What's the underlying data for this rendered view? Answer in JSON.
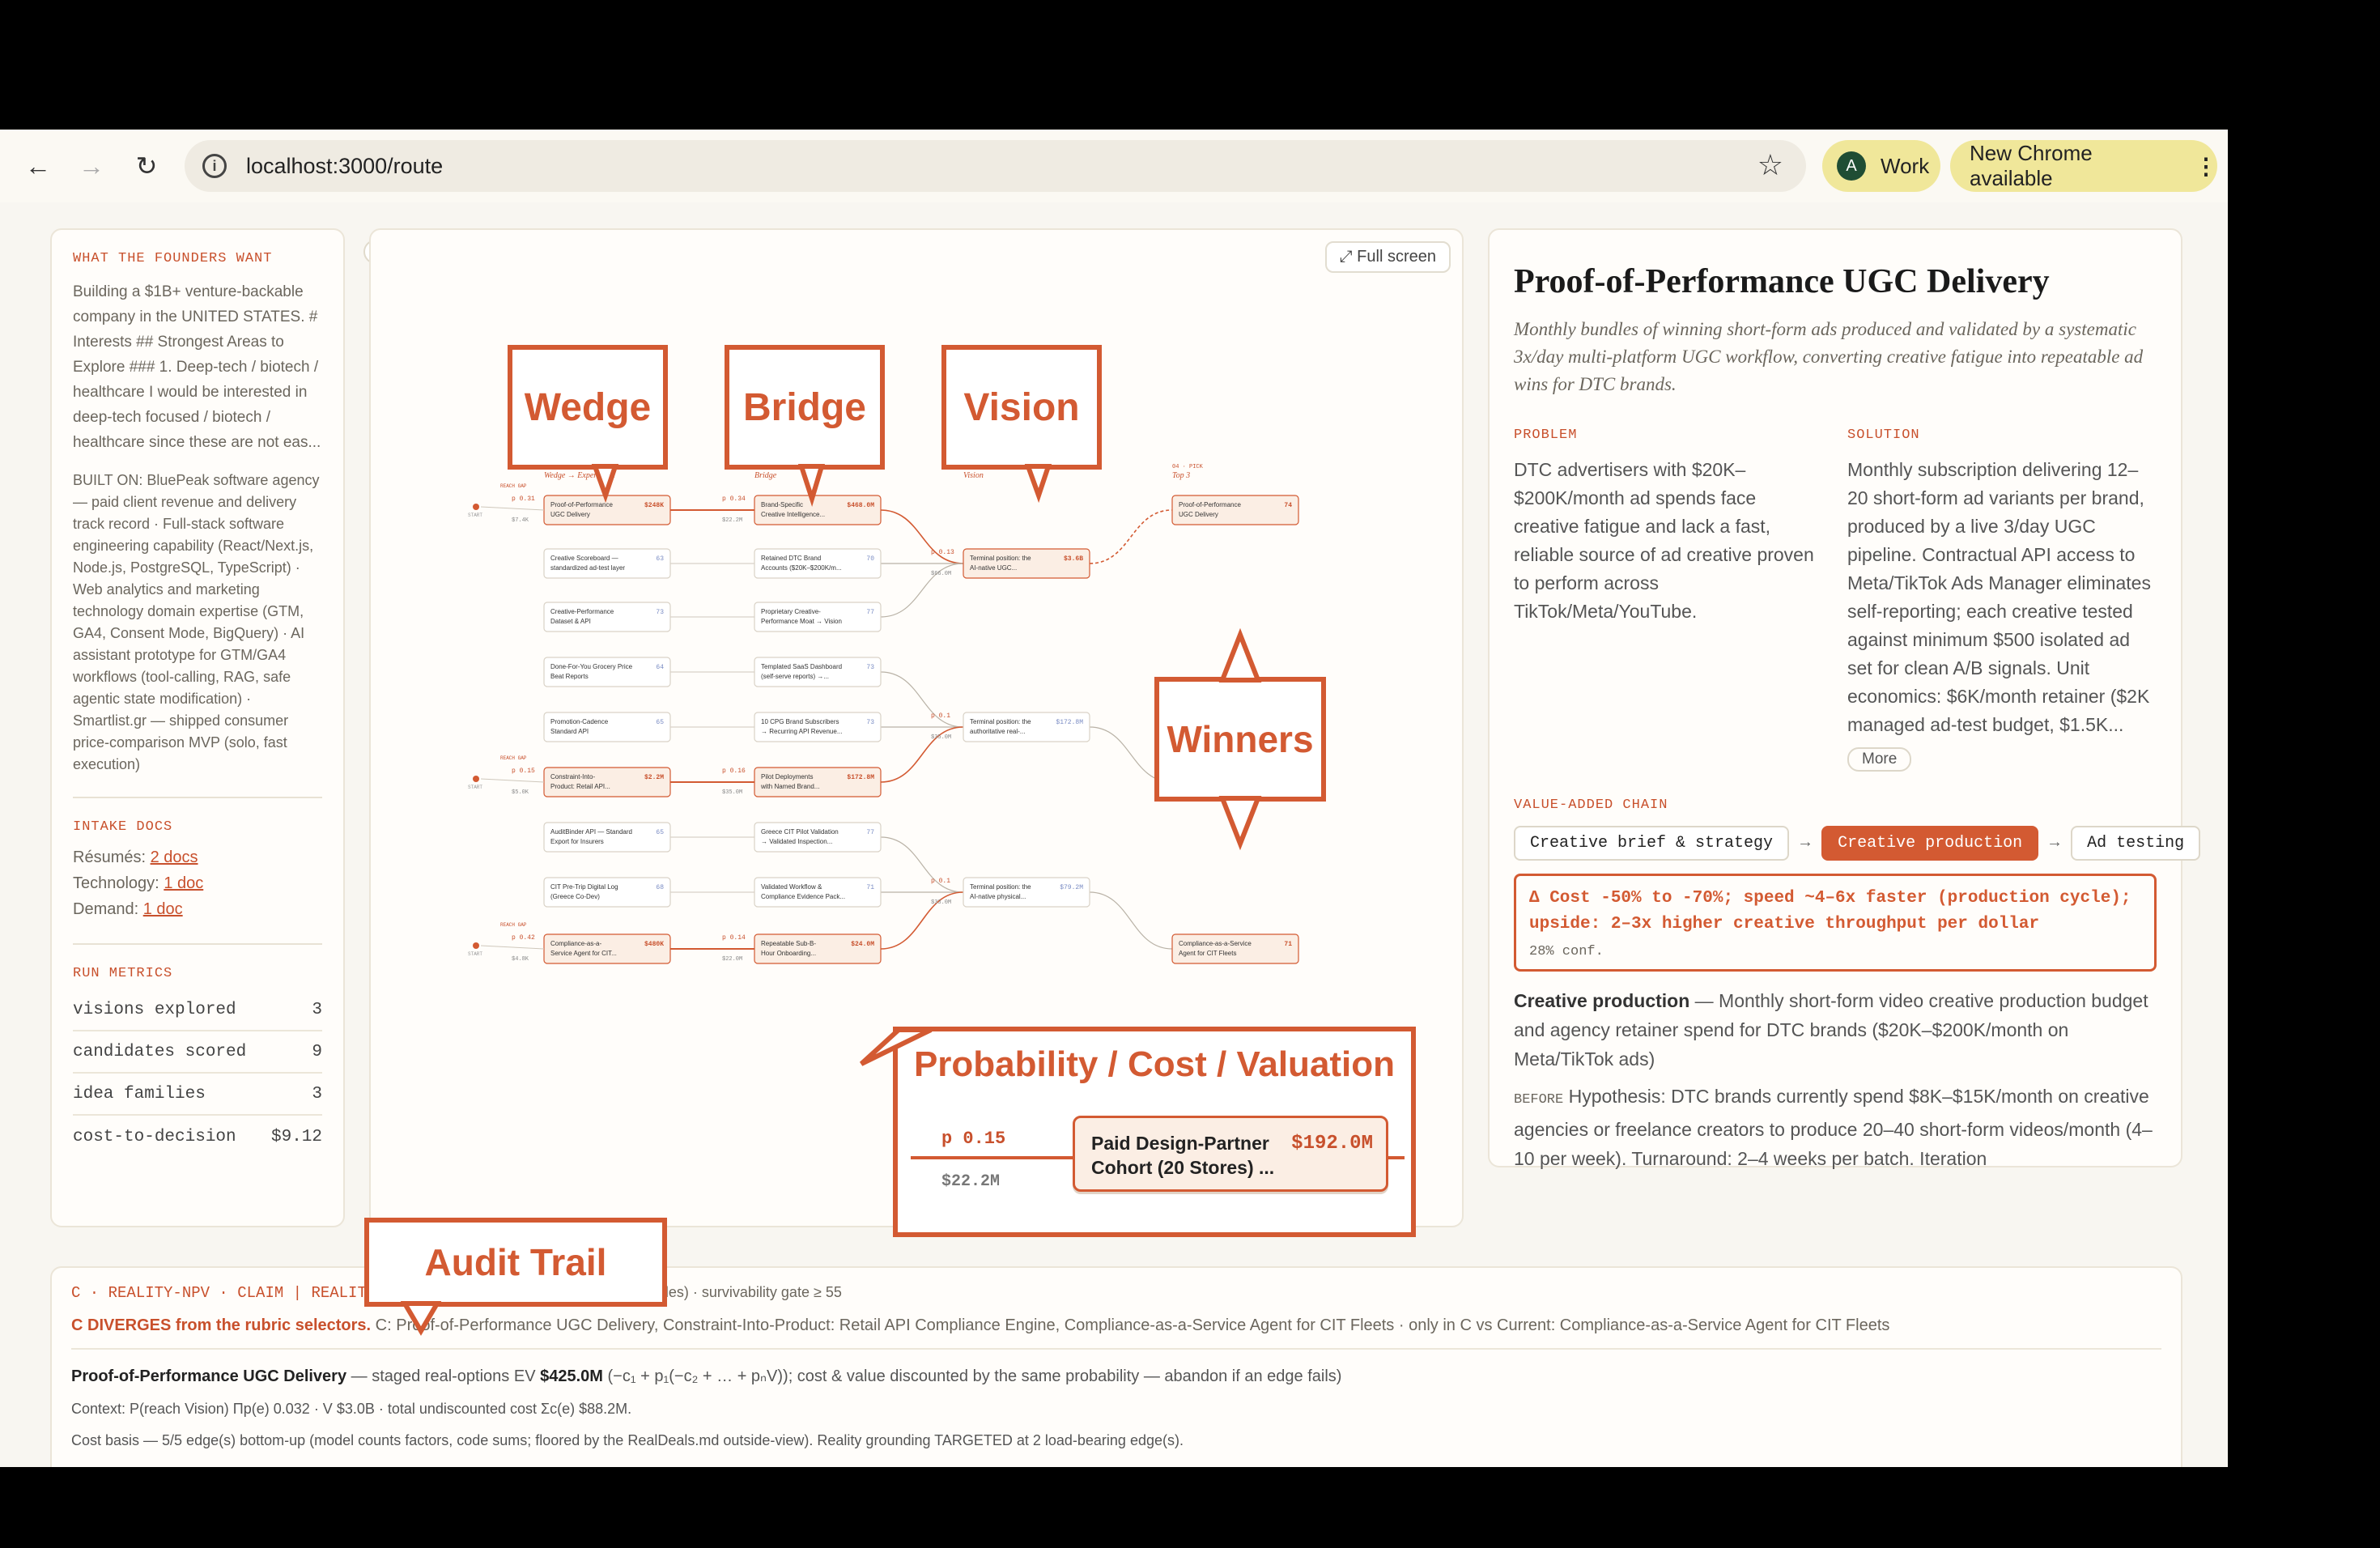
{
  "browser": {
    "url": "localhost:3000/route",
    "profile_initial": "A",
    "profile_label": "Work",
    "update_label": "New Chrome available"
  },
  "left": {
    "founders_title": "WHAT THE FOUNDERS WANT",
    "founders_text": "Building a $1B+ venture-backable company in the UNITED STATES. # Interests ## Strongest Areas to Explore ### 1. Deep-tech / biotech / healthcare I would be interested in deep-tech focused / biotech / healthcare since these are not eas...",
    "built_on": "BUILT ON: BluePeak software agency — paid client revenue and delivery track record · Full-stack software engineering capability (React/Next.js, Node.js, PostgreSQL, TypeScript) · Web analytics and marketing technology domain expertise (GTM, GA4, Consent Mode, BigQuery) · AI assistant prototype for GTM/GA4 workflows (tool-calling, RAG, safe agentic state modification) · Smartlist.gr — shipped consumer price-comparison MVP (solo, fast execution)",
    "intake_title": "INTAKE DOCS",
    "intake": [
      {
        "label": "Résumés:",
        "link": "2 docs"
      },
      {
        "label": "Technology:",
        "link": "1 doc"
      },
      {
        "label": "Demand:",
        "link": "1 doc"
      }
    ],
    "metrics_title": "RUN METRICS",
    "metrics": [
      {
        "label": "visions explored",
        "value": "3"
      },
      {
        "label": "candidates scored",
        "value": "9"
      },
      {
        "label": "idea families",
        "value": "3"
      },
      {
        "label": "cost-to-decision",
        "value": "$9.12"
      }
    ]
  },
  "graph": {
    "fullscreen_label": "⤢ Full screen",
    "callouts": {
      "wedge": "Wedge",
      "bridge": "Bridge",
      "vision": "Vision",
      "winners": "Winners",
      "probability": "Probability / Cost / Valuation",
      "audit": "Audit Trail"
    },
    "columns": [
      {
        "meta": "01 · ENTRY",
        "title": "Wedge → Experiment"
      },
      {
        "meta": "02 · PATH",
        "title": "Bridge"
      },
      {
        "meta": "03 · ENDGAME",
        "title": "Vision"
      },
      {
        "meta": "04 · PICK",
        "title": "Top 3"
      }
    ],
    "start_label": "START",
    "reach_label": "REACH GAP",
    "wedges": [
      {
        "l1": "Proof-of-Performance",
        "l2": "UGC Delivery",
        "value": "$248K",
        "p": "p 0.31",
        "cost": "$7.4K"
      },
      {
        "l1": "Creative Scoreboard —",
        "l2": "standardized ad-test layer",
        "value": "63"
      },
      {
        "l1": "Creative-Performance",
        "l2": "Dataset & API",
        "value": "73"
      },
      {
        "l1": "Done-For-You Grocery Price",
        "l2": "Beat Reports",
        "value": "64"
      },
      {
        "l1": "Promotion-Cadence",
        "l2": "Standard API",
        "value": "65"
      },
      {
        "l1": "Constraint-Into-",
        "l2": "Product: Retail API...",
        "value": "$2.2M",
        "p": "p 0.15",
        "cost": "$5.0K"
      },
      {
        "l1": "AuditBinder API — Standard",
        "l2": "Export for Insurers",
        "value": "65"
      },
      {
        "l1": "CIT Pre-Trip Digital Log",
        "l2": "(Greece Co-Dev)",
        "value": "68"
      },
      {
        "l1": "Compliance-as-a-",
        "l2": "Service Agent for CIT...",
        "value": "$480K",
        "p": "p 0.42",
        "cost": "$4.8K"
      }
    ],
    "bridges": [
      {
        "l1": "Brand-Specific",
        "l2": "Creative Intelligence...",
        "value": "$468.0M",
        "p": "p 0.34",
        "cost": "$22.2M"
      },
      {
        "l1": "Retained DTC Brand",
        "l2": "Accounts ($20K–$200K/m...",
        "value": "70"
      },
      {
        "l1": "Proprietary Creative-",
        "l2": "Performance Moat → Vision",
        "value": "77"
      },
      {
        "l1": "Templated SaaS Dashboard",
        "l2": "(self-serve reports) →...",
        "value": "73"
      },
      {
        "l1": "10 CPG Brand Subscribers",
        "l2": "→ Recurring API Revenue...",
        "value": "73"
      },
      {
        "l1": "Pilot Deployments",
        "l2": "with Named Brand...",
        "value": "$172.8M",
        "p": "p 0.16",
        "cost": "$35.0M"
      },
      {
        "l1": "Greece CIT Pilot Validation",
        "l2": "→ Validated Inspection...",
        "value": "77"
      },
      {
        "l1": "Validated Workflow &",
        "l2": "Compliance Evidence Pack...",
        "value": "71"
      },
      {
        "l1": "Repeatable Sub-B-",
        "l2": "Hour Onboarding...",
        "value": "$24.0M",
        "p": "p 0.14",
        "cost": "$22.0M"
      }
    ],
    "visions": [
      {
        "l1": "Terminal position: the",
        "l2": "AI-native UGC...",
        "value": "$3.6B",
        "p": "p 0.13",
        "cost": "$66.0M"
      },
      {
        "l1": "Terminal position: the",
        "l2": "authoritative real-...",
        "value": "$172.8M",
        "p": "p 0.1",
        "cost": "$35.0M"
      },
      {
        "l1": "Terminal position: the",
        "l2": "AI-native physical...",
        "value": "$79.2M",
        "p": "p 0.1",
        "cost": "$33.0M"
      }
    ],
    "winners": [
      {
        "l1": "Proof-of-Performance",
        "l2": "UGC Delivery",
        "value": "74"
      },
      {
        "l1": "Constraint-Into-Product:",
        "l2": "Retail API Compliance...",
        "value": "71"
      },
      {
        "l1": "Compliance-as-a-Service",
        "l2": "Agent for CIT Fleets",
        "value": "71"
      }
    ],
    "zoom": {
      "p": "p 0.15",
      "cost": "$22.2M",
      "l1": "Paid Design-Partner",
      "l2": "Cohort (20 Stores) ...",
      "value": "$192.0M"
    }
  },
  "detail": {
    "title": "Proof-of-Performance UGC Delivery",
    "subtitle": "Monthly bundles of winning short-form ads produced and validated by a systematic 3x/day multi-platform UGC workflow, converting creative fatigue into repeatable ad wins for DTC brands.",
    "problem_title": "PROBLEM",
    "problem": "DTC advertisers with $20K–$200K/month ad spends face creative fatigue and lack a fast, reliable source of ad creative proven to perform across TikTok/Meta/YouTube.",
    "solution_title": "SOLUTION",
    "solution": "Monthly subscription delivering 12–20 short-form ad variants per brand, produced by a live 3/day UGC pipeline. Contractual API access to Meta/TikTok Ads Manager eliminates self-reporting; each creative tested against minimum $500 isolated ad set for clean A/B signals. Unit economics: $6K/month retainer ($2K managed ad-test budget, $1.5K...",
    "more_label": "More",
    "chain_title": "VALUE-ADDED CHAIN",
    "chain": [
      "Creative brief & strategy",
      "Creative production",
      "Ad testing"
    ],
    "delta": "Δ Cost -50% to -70%; speed ~4–6x faster (production cycle); upside: 2–3x higher creative throughput per dollar",
    "confidence": "28% conf.",
    "stage_name": "Creative production",
    "stage_desc": " — Monthly short-form video creative production budget and agency retainer spend for DTC brands ($20K–$200K/month on Meta/TikTok ads)",
    "before_label": "BEFORE",
    "before_text": " Hypothesis: DTC brands currently spend $8K–$15K/month on creative agencies or freelance creators to produce 20–40 short-form videos/month (4–10 per week). Turnaround: 2–4 weeks per batch. Iteration"
  },
  "audit": {
    "header": "C · REALITY-NPV · CLAIM | REALITY FIREWALL",
    "channel": "reality channel: live (web particles) · survivability gate ≥ 55",
    "diverge_bold": "C DIVERGES from the rubric selectors.",
    "diverge_text": " C: Proof-of-Performance UGC Delivery, Constraint-Into-Product: Retail API Compliance Engine, Compliance-as-a-Service Agent for CIT Fleets · only in C vs Current: Compliance-as-a-Service Agent for CIT Fleets",
    "claim_name": "Proof-of-Performance UGC Delivery",
    "claim_mid": " — staged real-options EV ",
    "claim_ev": "$425.0M",
    "claim_rest": " (−c₁ + p₁(−c₂ + … + pₙV)); cost & value discounted by the same probability — abandon if an edge fails)",
    "context": "Context: P(reach Vision) Πp(e) 0.032 · V $3.0B · total undiscounted cost Σc(e) $88.2M.",
    "cost_basis": "Cost basis — 5/5 edge(s) bottom-up (model counts factors, code sums; floored by the RealDeals.md outside-view). Reality grounding TARGETED at 2 load-bearing edge(s)."
  }
}
